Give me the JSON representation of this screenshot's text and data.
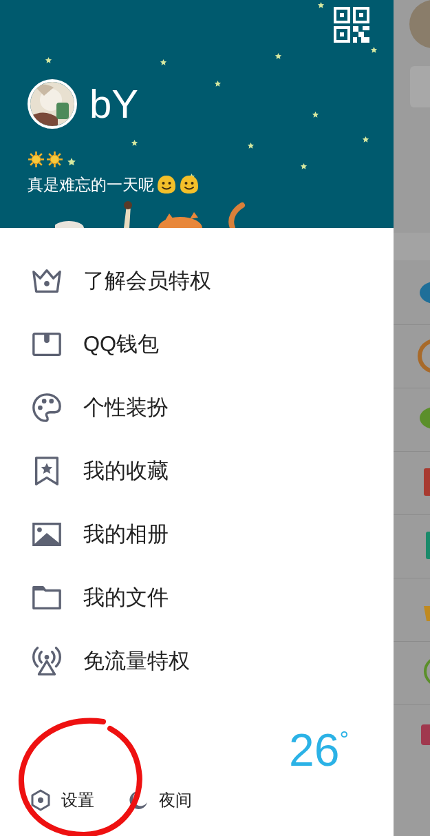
{
  "profile": {
    "name": "bY",
    "level_icons": [
      {
        "kind": "sun"
      },
      {
        "kind": "sun"
      },
      {
        "kind": "star"
      }
    ],
    "signature": "真是难忘的一天呢",
    "signature_emojis": [
      {
        "kind": "smiley"
      },
      {
        "kind": "smiley"
      }
    ]
  },
  "menu": [
    {
      "kind": "crown",
      "label": "了解会员特权"
    },
    {
      "kind": "wallet",
      "label": "QQ钱包"
    },
    {
      "kind": "palette",
      "label": "个性装扮"
    },
    {
      "kind": "bookmark",
      "label": "我的收藏"
    },
    {
      "kind": "image",
      "label": "我的相册"
    },
    {
      "kind": "folder",
      "label": "我的文件"
    },
    {
      "kind": "antenna",
      "label": "免流量特权"
    }
  ],
  "weather": {
    "temperature": "26",
    "unit": "°"
  },
  "bottom_actions": [
    {
      "kind": "settings",
      "label": "设置"
    },
    {
      "kind": "night",
      "label": "夜间"
    }
  ]
}
